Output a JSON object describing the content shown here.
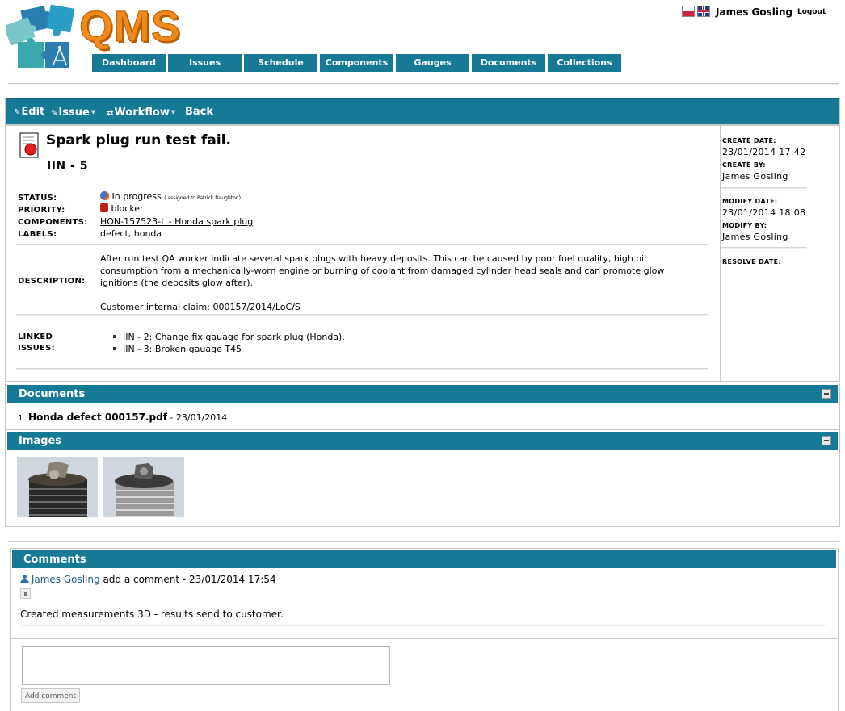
{
  "header": {
    "brand": "QMS",
    "user_name": "James Gosling",
    "logout_label": "Logout",
    "nav": [
      "Dashboard",
      "Issues",
      "Schedule",
      "Components",
      "Gauges",
      "Documents",
      "Collections"
    ]
  },
  "toolbar": {
    "edit": "Edit",
    "issue": "Issue",
    "workflow": "Workflow",
    "back": "Back"
  },
  "issue": {
    "title": "Spark plug run test fail.",
    "code": "IIN - 5",
    "status_label": "STATUS:",
    "status_value": "In progress",
    "status_assignee": "( assigned to Patrick Naughton)",
    "priority_label": "PRIORITY:",
    "priority_value": "blocker",
    "components_label": "COMPONENTS:",
    "components_value": "HON-157523-L - Honda spark plug",
    "labels_label": "LABELS:",
    "labels_value": "defect, honda",
    "description_label": "DESCRIPTION:",
    "description_text": "After run test QA worker indicate several spark plugs with heavy deposits. This can be caused by poor fuel quality, high oil consumption from a mechanically-worn engine or burning of coolant from damaged cylinder head seals and can promote glow ignitions (the deposits glow after).",
    "description_claim": "Customer internal claim: 000157/2014/LoC/S",
    "linked_label_1": "LINKED",
    "linked_label_2": "ISSUES:",
    "linked": [
      "IIN - 2: Change fix gauage for spark plug (Honda).",
      "IIN - 3: Broken gauage T45"
    ]
  },
  "side": {
    "create_date_label": "CREATE DATE:",
    "create_date": "23/01/2014 17:42",
    "create_by_label": "CREATE BY:",
    "create_by": "James Gosling",
    "modify_date_label": "MODIFY DATE:",
    "modify_date": "23/01/2014 18:08",
    "modify_by_label": "MODIFY BY:",
    "modify_by": "James Gosling",
    "resolve_date_label": "RESOLVE DATE:"
  },
  "documents": {
    "title": "Documents",
    "items": [
      {
        "index": "1.",
        "name": "Honda defect 000157.pdf",
        "date": " - 23/01/2014"
      }
    ]
  },
  "images": {
    "title": "Images"
  },
  "comments": {
    "title": "Comments",
    "author": "James Gosling",
    "meta": " add a comment - 23/01/2014 17:54",
    "text": "Created measurements 3D - results send to customer.",
    "add_button": "Add comment"
  },
  "colors": {
    "accent": "#167a97",
    "brand_orange": "#f08a1c",
    "puzzle_teal": "#3aa8ad",
    "puzzle_blue": "#2a7fb0"
  }
}
